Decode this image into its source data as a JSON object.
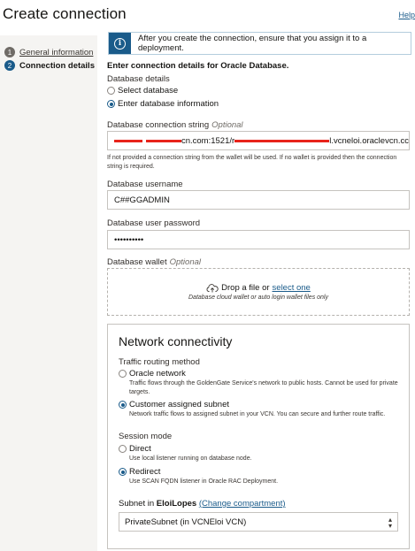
{
  "page": {
    "title": "Create connection",
    "help_label": "Help"
  },
  "steps": [
    {
      "num": "1",
      "label": "General information",
      "state": "done"
    },
    {
      "num": "2",
      "label": "Connection details",
      "state": "current"
    }
  ],
  "info_banner": {
    "text": "After you create the connection, ensure that you assign it to a deployment."
  },
  "section_title": "Enter connection details for Oracle Database.",
  "database_details": {
    "label": "Database details",
    "options": [
      {
        "label": "Select database",
        "selected": false
      },
      {
        "label": "Enter database information",
        "selected": true
      }
    ]
  },
  "connection_string": {
    "label": "Database connection string",
    "optional": "Optional",
    "value_parts": [
      "cn.com:1521/r",
      "l.vcneloi.oraclevcn.cc"
    ],
    "help": "If not provided a connection string from the wallet will be used. If no wallet is provided then the connection string is required."
  },
  "username": {
    "label": "Database username",
    "value": "C##GGADMIN"
  },
  "password": {
    "label": "Database user password",
    "value": "••••••••••"
  },
  "wallet": {
    "label": "Database wallet",
    "optional": "Optional",
    "drop_text": "Drop a file or",
    "select_link": "select one",
    "hint": "Database cloud wallet or auto login wallet files only"
  },
  "network": {
    "title": "Network connectivity",
    "routing_label": "Traffic routing method",
    "routing_options": [
      {
        "label": "Oracle network",
        "desc": "Traffic flows through the GoldenGate Service's network to public hosts. Cannot be used for private targets.",
        "selected": false
      },
      {
        "label": "Customer assigned subnet",
        "desc": "Network traffic flows to assigned subnet in your VCN. You can secure and further route traffic.",
        "selected": true
      }
    ],
    "session_label": "Session mode",
    "session_options": [
      {
        "label": "Direct",
        "desc": "Use local listener running on database node.",
        "selected": false
      },
      {
        "label": "Redirect",
        "desc": "Use SCAN FQDN listener in Oracle RAC Deployment.",
        "selected": true
      }
    ],
    "subnet_prefix": "Subnet in",
    "compartment": "EloiLopes",
    "change_compartment": "(Change compartment)",
    "subnet_value": "PrivateSubnet (in VCNEloi VCN)"
  }
}
